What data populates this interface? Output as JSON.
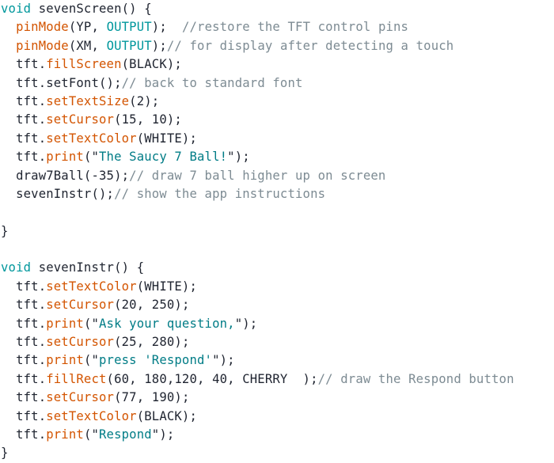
{
  "document": {
    "kind": "source-code-listing",
    "language": "Arduino C++",
    "background_color": "#ffffff",
    "colors": {
      "keyword": "#00979c",
      "constant": "#00979c",
      "function": "#d35400",
      "string": "#007c86",
      "comment": "#7d8b93",
      "plain": "#1f2430"
    }
  },
  "lines": [
    {
      "id": "line-1",
      "tokens": [
        {
          "t": "keyword",
          "s": "void"
        },
        {
          "t": "plain",
          "s": " sevenScreen() {"
        }
      ]
    },
    {
      "id": "line-2",
      "tokens": [
        {
          "t": "plain",
          "s": "  "
        },
        {
          "t": "function",
          "s": "pinMode"
        },
        {
          "t": "plain",
          "s": "(YP, "
        },
        {
          "t": "constant",
          "s": "OUTPUT"
        },
        {
          "t": "plain",
          "s": ");  "
        },
        {
          "t": "comment",
          "s": "//restore the TFT control pins"
        }
      ]
    },
    {
      "id": "line-3",
      "tokens": [
        {
          "t": "plain",
          "s": "  "
        },
        {
          "t": "function",
          "s": "pinMode"
        },
        {
          "t": "plain",
          "s": "(XM, "
        },
        {
          "t": "constant",
          "s": "OUTPUT"
        },
        {
          "t": "plain",
          "s": ");"
        },
        {
          "t": "comment",
          "s": "// for display after detecting a touch"
        }
      ]
    },
    {
      "id": "line-4",
      "tokens": [
        {
          "t": "plain",
          "s": "  tft."
        },
        {
          "t": "function",
          "s": "fillScreen"
        },
        {
          "t": "plain",
          "s": "(BLACK);"
        }
      ]
    },
    {
      "id": "line-5",
      "tokens": [
        {
          "t": "plain",
          "s": "  tft.setFont();"
        },
        {
          "t": "comment",
          "s": "// back to standard font"
        }
      ]
    },
    {
      "id": "line-6",
      "tokens": [
        {
          "t": "plain",
          "s": "  tft."
        },
        {
          "t": "function",
          "s": "setTextSize"
        },
        {
          "t": "plain",
          "s": "(2);"
        }
      ]
    },
    {
      "id": "line-7",
      "tokens": [
        {
          "t": "plain",
          "s": "  tft."
        },
        {
          "t": "function",
          "s": "setCursor"
        },
        {
          "t": "plain",
          "s": "(15, 10);"
        }
      ]
    },
    {
      "id": "line-8",
      "tokens": [
        {
          "t": "plain",
          "s": "  tft."
        },
        {
          "t": "function",
          "s": "setTextColor"
        },
        {
          "t": "plain",
          "s": "(WHITE);"
        }
      ]
    },
    {
      "id": "line-9",
      "tokens": [
        {
          "t": "plain",
          "s": "  tft."
        },
        {
          "t": "function",
          "s": "print"
        },
        {
          "t": "plain",
          "s": "(\""
        },
        {
          "t": "string",
          "s": "The Saucy 7 Ball!"
        },
        {
          "t": "plain",
          "s": "\");"
        }
      ]
    },
    {
      "id": "line-10",
      "tokens": [
        {
          "t": "plain",
          "s": "  draw7Ball(-35);"
        },
        {
          "t": "comment",
          "s": "// draw 7 ball higher up on screen"
        }
      ]
    },
    {
      "id": "line-11",
      "tokens": [
        {
          "t": "plain",
          "s": "  sevenInstr();"
        },
        {
          "t": "comment",
          "s": "// show the app instructions"
        }
      ]
    },
    {
      "id": "line-12",
      "tokens": []
    },
    {
      "id": "line-13",
      "tokens": [
        {
          "t": "plain",
          "s": "}"
        }
      ]
    },
    {
      "id": "line-14",
      "tokens": []
    },
    {
      "id": "line-15",
      "tokens": [
        {
          "t": "keyword",
          "s": "void"
        },
        {
          "t": "plain",
          "s": " sevenInstr() {"
        }
      ]
    },
    {
      "id": "line-16",
      "tokens": [
        {
          "t": "plain",
          "s": "  tft."
        },
        {
          "t": "function",
          "s": "setTextColor"
        },
        {
          "t": "plain",
          "s": "(WHITE);"
        }
      ]
    },
    {
      "id": "line-17",
      "tokens": [
        {
          "t": "plain",
          "s": "  tft."
        },
        {
          "t": "function",
          "s": "setCursor"
        },
        {
          "t": "plain",
          "s": "(20, 250);"
        }
      ]
    },
    {
      "id": "line-18",
      "tokens": [
        {
          "t": "plain",
          "s": "  tft."
        },
        {
          "t": "function",
          "s": "print"
        },
        {
          "t": "plain",
          "s": "(\""
        },
        {
          "t": "string",
          "s": "Ask your question,"
        },
        {
          "t": "plain",
          "s": "\");"
        }
      ]
    },
    {
      "id": "line-19",
      "tokens": [
        {
          "t": "plain",
          "s": "  tft."
        },
        {
          "t": "function",
          "s": "setCursor"
        },
        {
          "t": "plain",
          "s": "(25, 280);"
        }
      ]
    },
    {
      "id": "line-20",
      "tokens": [
        {
          "t": "plain",
          "s": "  tft."
        },
        {
          "t": "function",
          "s": "print"
        },
        {
          "t": "plain",
          "s": "(\""
        },
        {
          "t": "string",
          "s": "press 'Respond'"
        },
        {
          "t": "plain",
          "s": "\");"
        }
      ]
    },
    {
      "id": "line-21",
      "tokens": [
        {
          "t": "plain",
          "s": "  tft."
        },
        {
          "t": "function",
          "s": "fillRect"
        },
        {
          "t": "plain",
          "s": "(60, 180,120, 40, CHERRY  );"
        },
        {
          "t": "comment",
          "s": "// draw the Respond button"
        }
      ]
    },
    {
      "id": "line-22",
      "tokens": [
        {
          "t": "plain",
          "s": "  tft."
        },
        {
          "t": "function",
          "s": "setCursor"
        },
        {
          "t": "plain",
          "s": "(77, 190);"
        }
      ]
    },
    {
      "id": "line-23",
      "tokens": [
        {
          "t": "plain",
          "s": "  tft."
        },
        {
          "t": "function",
          "s": "setTextColor"
        },
        {
          "t": "plain",
          "s": "(BLACK);"
        }
      ]
    },
    {
      "id": "line-24",
      "tokens": [
        {
          "t": "plain",
          "s": "  tft."
        },
        {
          "t": "function",
          "s": "print"
        },
        {
          "t": "plain",
          "s": "(\""
        },
        {
          "t": "string",
          "s": "Respond"
        },
        {
          "t": "plain",
          "s": "\");"
        }
      ]
    },
    {
      "id": "line-25",
      "tokens": [
        {
          "t": "plain",
          "s": "}"
        }
      ]
    }
  ]
}
